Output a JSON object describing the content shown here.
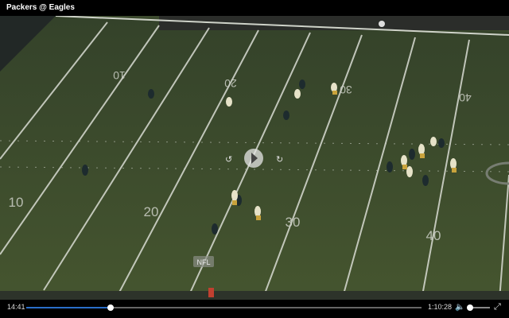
{
  "window": {
    "title": "Packers @ Eagles"
  },
  "field": {
    "yard_numbers": [
      "10",
      "20",
      "30",
      "40",
      "10",
      "20",
      "30",
      "40"
    ],
    "logo": "NFL"
  },
  "player": {
    "current_time": "14:41",
    "duration": "1:10:28",
    "progress": 0.213,
    "volume": 0.1,
    "icons": {
      "play": "play-icon",
      "rewind": "rewind-icon",
      "forward": "forward-icon",
      "volume": "volume-icon",
      "fullscreen": "fullscreen-icon"
    },
    "colors": {
      "progress": "#2a6ec9",
      "field": "#3c4a2e"
    }
  }
}
